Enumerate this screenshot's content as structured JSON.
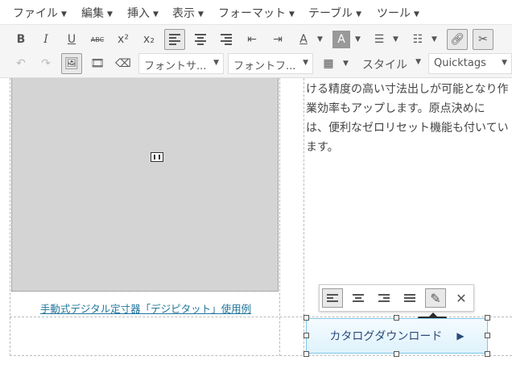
{
  "menubar": {
    "items": [
      {
        "label": "ファイル"
      },
      {
        "label": "編集"
      },
      {
        "label": "挿入"
      },
      {
        "label": "表示"
      },
      {
        "label": "フォーマット"
      },
      {
        "label": "テーブル"
      },
      {
        "label": "ツール"
      }
    ]
  },
  "toolbar": {
    "row1": [
      {
        "name": "bold-button",
        "glyph": "B"
      },
      {
        "name": "italic-button",
        "glyph": "I"
      },
      {
        "name": "underline-button",
        "glyph": "U"
      },
      {
        "name": "strikethrough-button",
        "glyph": "ABC"
      },
      {
        "name": "superscript-button",
        "glyph": "x²"
      },
      {
        "name": "subscript-button",
        "glyph": "x₂"
      }
    ],
    "font_size_select": "フォントサ...",
    "font_family_select": "フォントフ...",
    "style_select": "スタイル",
    "quicktags_select": "Quicktags"
  },
  "content": {
    "image_caption": "手動式デジタル定寸器「デジピタット」使用例",
    "paragraph": "ける精度の高い寸法出しが可能となり作\n業効率もアップします。原点決めに\nは、便利なゼロリセット機能も付いてい\nます。",
    "download_button": "カタログダウンロード",
    "download_arrow": "▶",
    "tooltip": "編集"
  },
  "colors": {
    "link": "#21759b",
    "button_border": "#7dc6e8",
    "button_text": "#2b4a7a"
  }
}
